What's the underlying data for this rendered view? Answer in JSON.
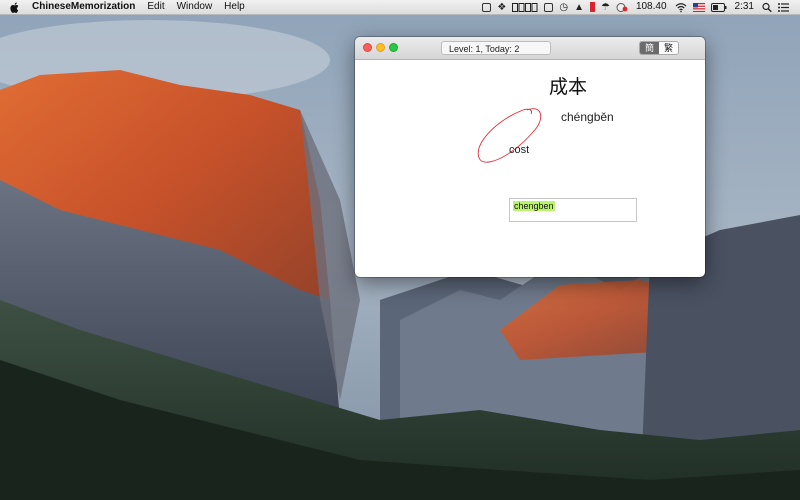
{
  "menubar": {
    "app_name": "ChineseMemorization",
    "menus": [
      "Edit",
      "Window",
      "Help"
    ],
    "price": "108.40",
    "time": "2:31",
    "status_icons": [
      "airplay-icon",
      "dropbox-icon",
      "battery-bars-icon",
      "window-icon",
      "timemachine-icon",
      "hat-icon",
      "record-icon",
      "umbrella-icon",
      "badge-icon",
      "wifi-icon",
      "flag-us-icon",
      "battery-icon",
      "search-icon",
      "list-icon"
    ]
  },
  "window": {
    "status": "Level: 1,  Today: 2",
    "toggle": {
      "simplified": "簡",
      "traditional": "繁",
      "active": "simplified"
    },
    "word": {
      "hanzi": "成本",
      "pinyin": "chéngběn",
      "meaning": "cost"
    },
    "answer_input": {
      "value": "chengben"
    }
  },
  "colors": {
    "accent_highlight": "#b9f46c",
    "stroke": "#e0303a",
    "toggle_active": "#6b6b6b"
  }
}
